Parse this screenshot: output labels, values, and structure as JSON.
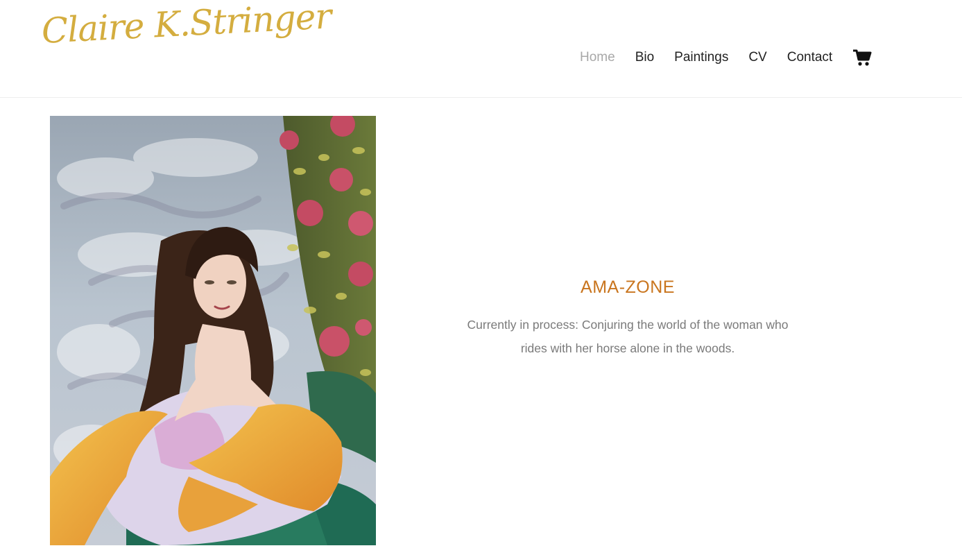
{
  "brand": {
    "logo_text": "Claire K.Stringer",
    "color": "#d4ad3f"
  },
  "nav": {
    "items": [
      {
        "label": "Home",
        "active": true
      },
      {
        "label": "Bio",
        "active": false
      },
      {
        "label": "Paintings",
        "active": false
      },
      {
        "label": "CV",
        "active": false
      },
      {
        "label": "Contact",
        "active": false
      }
    ],
    "cart_icon": "shopping-cart-icon"
  },
  "feature": {
    "title": "AMA-ZONE",
    "description": "Currently in process: Conjuring the world of the woman who rides with her horse alone in the woods.",
    "accent_color": "#c9751e"
  }
}
